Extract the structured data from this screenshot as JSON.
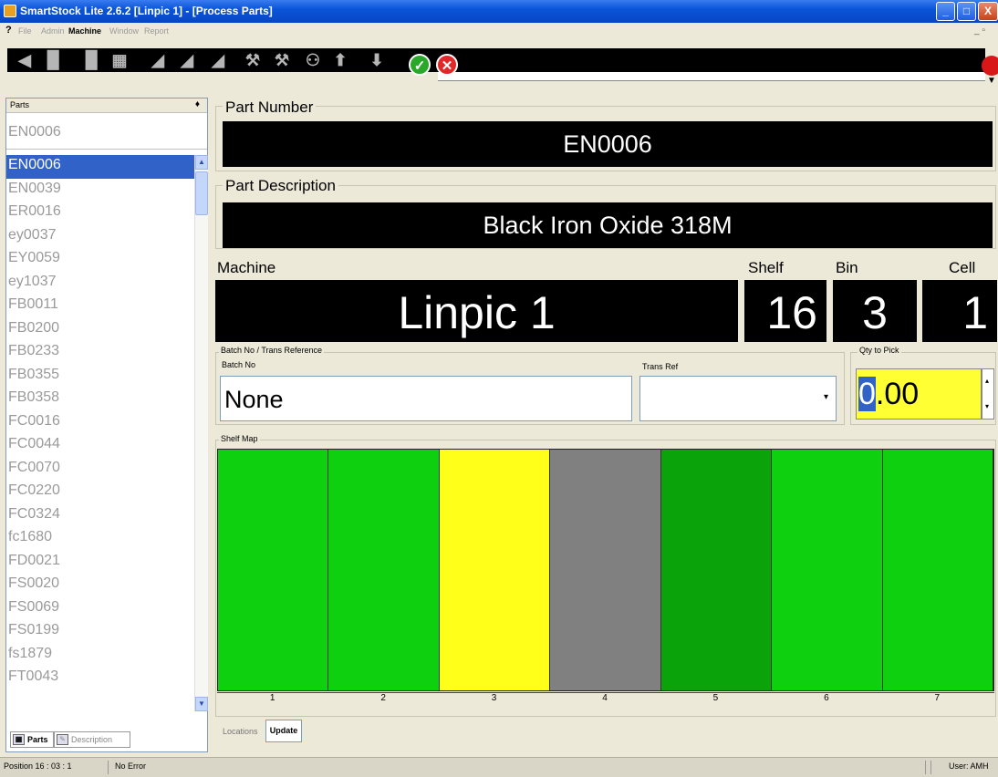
{
  "window": {
    "title": "SmartStock Lite 2.6.2 [Linpic 1] - [Process Parts]",
    "min_glyph": "_",
    "max_glyph": "□",
    "close_glyph": "X"
  },
  "menu": {
    "help": "?",
    "items": [
      "File",
      "Admin",
      "Machine",
      "Window",
      "Report"
    ],
    "active_item": "Machine",
    "mdi_controls": "_ ▫"
  },
  "toolbar": {
    "ok_glyph": "✓",
    "cancel_glyph": "✕",
    "pin_glyph": "▼"
  },
  "parts_panel": {
    "header": "Parts",
    "pin_glyph": "♦",
    "search_value": "EN0006",
    "items": [
      "EN0006",
      "EN0039",
      "ER0016",
      "ey0037",
      "EY0059",
      "ey1037",
      "FB0011",
      "FB0200",
      "FB0233",
      "FB0355",
      "FB0358",
      "FC0016",
      "FC0044",
      "FC0070",
      "FC0220",
      "FC0324",
      "fc1680",
      "FD0021",
      "FS0020",
      "FS0069",
      "FS0199",
      "fs1879",
      "FT0043"
    ],
    "selected": "EN0006",
    "tabs": [
      "Parts",
      "Description"
    ]
  },
  "part": {
    "number_label": "Part Number",
    "number": "EN0006",
    "description_label": "Part Description",
    "description": "Black Iron Oxide 318M"
  },
  "location": {
    "machine_label": "Machine",
    "machine": "Linpic 1",
    "shelf_label": "Shelf",
    "shelf": "16",
    "bin_label": "Bin",
    "bin": "3",
    "cell_label": "Cell",
    "cell": "1"
  },
  "batch": {
    "group_label": "Batch No / Trans Reference",
    "batch_label": "Batch No",
    "batch_value": "None",
    "trans_label": "Trans Ref",
    "trans_value": ""
  },
  "qty": {
    "label": "Qty to Pick",
    "value_selected": "0",
    "value_rest": ".00"
  },
  "shelf_map": {
    "label": "Shelf Map",
    "bins": [
      {
        "number": "1",
        "color": "#0fd00f"
      },
      {
        "number": "2",
        "color": "#0fd00f"
      },
      {
        "number": "3",
        "color": "#ffff1a"
      },
      {
        "number": "4",
        "color": "#808080"
      },
      {
        "number": "5",
        "color": "#0aa40a"
      },
      {
        "number": "6",
        "color": "#0fd00f"
      },
      {
        "number": "7",
        "color": "#0fd00f"
      }
    ]
  },
  "locations": {
    "label": "Locations",
    "update_button": "Update"
  },
  "status": {
    "position": "Position 16 : 03 : 1",
    "error": "No Error",
    "user": "User: AMH"
  }
}
